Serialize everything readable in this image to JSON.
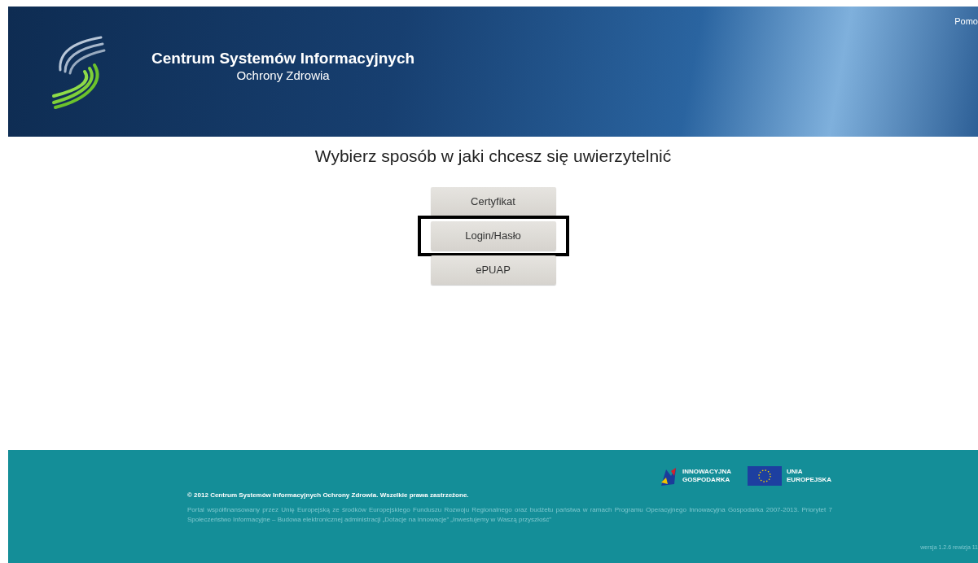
{
  "header": {
    "title": "Centrum Systemów Informacyjnych",
    "subtitle": "Ochrony Zdrowia",
    "help_link": "Pomo"
  },
  "main": {
    "heading": "Wybierz sposób w jaki chcesz się uwierzytelnić",
    "options": [
      {
        "label": "Certyfikat",
        "highlighted": false
      },
      {
        "label": "Login/Hasło",
        "highlighted": true
      },
      {
        "label": "ePUAP",
        "highlighted": false
      }
    ]
  },
  "footer": {
    "logos": [
      {
        "kind": "ig",
        "line1": "INNOWACYJNA",
        "line2": "GOSPODARKA"
      },
      {
        "kind": "eu",
        "line1": "UNIA",
        "line2": "EUROPEJSKA"
      }
    ],
    "copyright": "© 2012 Centrum Systemów Informacyjnych Ochrony Zdrowia. Wszelkie prawa zastrzeżone.",
    "funding_note": "Portal współfinansowany przez Unię Europejską ze środków Europejskiego Funduszu Rozwoju Regionalnego oraz budżetu państwa w ramach Programu Operacyjnego Innowacyjna Gospodarka 2007-2013. Priorytet 7 Społeczeństwo Informacyjne – Budowa elektronicznej administracji „Dotacje na innowacje” „Inwestujemy w Waszą przyszłość”",
    "version": "wersja 1.2.6 rewizja 11"
  }
}
